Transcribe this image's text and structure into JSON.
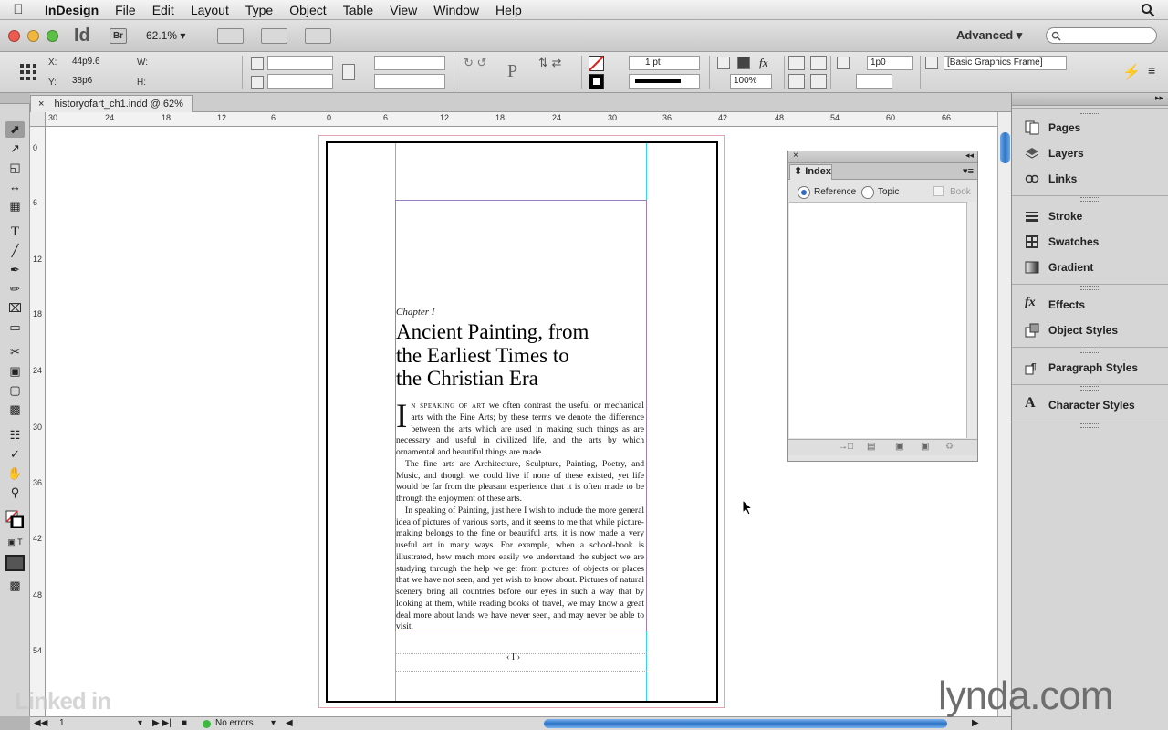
{
  "menubar": {
    "app_name": "InDesign",
    "items": [
      "File",
      "Edit",
      "Layout",
      "Type",
      "Object",
      "Table",
      "View",
      "Window",
      "Help"
    ]
  },
  "appbar": {
    "logo": "Id",
    "bridge": "Br",
    "zoom": "62.1%",
    "workspace": "Advanced"
  },
  "control": {
    "x_label": "X:",
    "x_value": "44p9.6",
    "y_label": "Y:",
    "y_value": "38p6",
    "w_label": "W:",
    "h_label": "H:",
    "stroke_weight": "1 pt",
    "opacity": "100%",
    "frame_offset": "1p0",
    "object_style": "[Basic Graphics Frame]"
  },
  "document": {
    "tab_title": "historyofart_ch1.indd @ 62%",
    "chapter_label": "Chapter I",
    "title_lines": [
      "Ancient Painting, from",
      "the Earliest Times to",
      "the Christian Era"
    ],
    "drop_cap": "I",
    "lead_in": "n speaking of art",
    "p1": "we often contrast the useful or mechanical arts with the Fine Arts; by these terms we denote the difference between the arts which are used in making such things as are necessary and useful in civilized life, and the arts by which ornamental and beautiful things are made.",
    "p2": "The fine arts are Architecture, Sculpture, Painting, Poetry, and Music, and though we could live if none of these existed, yet life would be far from the pleasant experience that it is often made to be through the enjoyment of these arts.",
    "p3": "In speaking of Painting, just here I wish to include the more general idea of pictures of various sorts, and it seems to me that while picture-making belongs to the fine or beautiful arts, it is now made a very useful art in many ways. For example, when a school-book is illustrated, how much more easily we understand the subject we are studying through the help we get from pictures of objects or places that we have not seen, and yet wish to know about. Pictures of natural scenery bring all countries before our eyes in such a way that by looking at them, while reading books of travel, we may know a great deal more about lands we have never seen, and may never be able to visit.",
    "folio": "I"
  },
  "rulers": {
    "h": [
      "30",
      "24",
      "18",
      "12",
      "6",
      "0",
      "6",
      "12",
      "18",
      "24",
      "30",
      "36",
      "42",
      "48",
      "54",
      "60",
      "66"
    ],
    "v": [
      "0",
      "6",
      "12",
      "18",
      "24",
      "30",
      "36",
      "42",
      "48",
      "54"
    ]
  },
  "index_panel": {
    "title": "Index",
    "reference_label": "Reference",
    "topic_label": "Topic",
    "book_label": "Book"
  },
  "dock": {
    "group1": [
      "Pages",
      "Layers",
      "Links"
    ],
    "group2": [
      "Stroke",
      "Swatches",
      "Gradient"
    ],
    "group3": [
      "Effects",
      "Object Styles"
    ],
    "group4": [
      "Paragraph Styles"
    ],
    "group5": [
      "Character Styles"
    ]
  },
  "status": {
    "page_number": "1",
    "preflight": "No errors"
  },
  "watermarks": {
    "linkedin": "Linked in",
    "lynda": "lynda.com"
  },
  "colors": {
    "accent_blue": "#2f76c9",
    "guide_cyan": "#35d6e8",
    "bleed_pink": "#e4a3b2",
    "frame_purple": "#9a7ec0"
  }
}
